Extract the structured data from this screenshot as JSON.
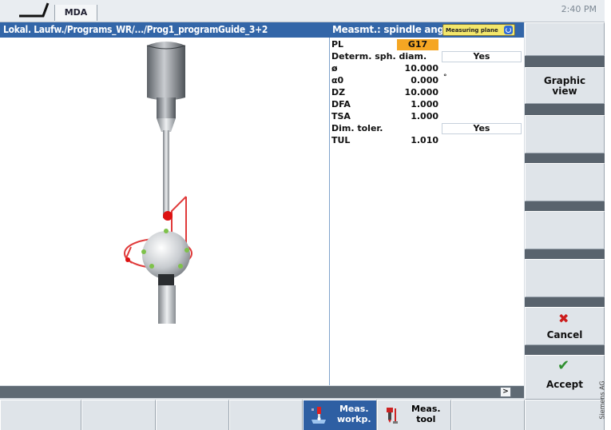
{
  "topbar": {
    "mode": "MDA",
    "clock": "2:40 PM"
  },
  "header": {
    "path": "Lokal. Laufw./Programs_WR/.../Prog1_programGuide_3+2",
    "title": "Measmt.: spindle ang",
    "measuring_plane": "Measuring plane"
  },
  "params": [
    {
      "label": "PL",
      "value": "G17",
      "highlight": true
    },
    {
      "label": "Determ. sph. diam.",
      "option": "Yes"
    },
    {
      "label": "ø",
      "value": "10.000"
    },
    {
      "label": "α0",
      "value": "0.000",
      "unit": "°"
    },
    {
      "label": "DZ",
      "value": "10.000"
    },
    {
      "label": "DFA",
      "value": "1.000"
    },
    {
      "label": "TSA",
      "value": "1.000"
    },
    {
      "label": "Dim. toler.",
      "option": "Yes"
    },
    {
      "label": "TUL",
      "value": "1.010"
    }
  ],
  "softkeys_right": {
    "graphic_view": "Graphic\nview",
    "cancel": "Cancel",
    "accept": "Accept"
  },
  "status": {
    "scroll": ">"
  },
  "softkeys_bottom": {
    "meas_workp": "Meas.\nworkp.",
    "meas_tool": "Meas.\ntool"
  },
  "credit": "Siemens AG",
  "colors": {
    "accent": "#3366a8",
    "highlight": "#f5a623",
    "gap": "#59636d"
  }
}
